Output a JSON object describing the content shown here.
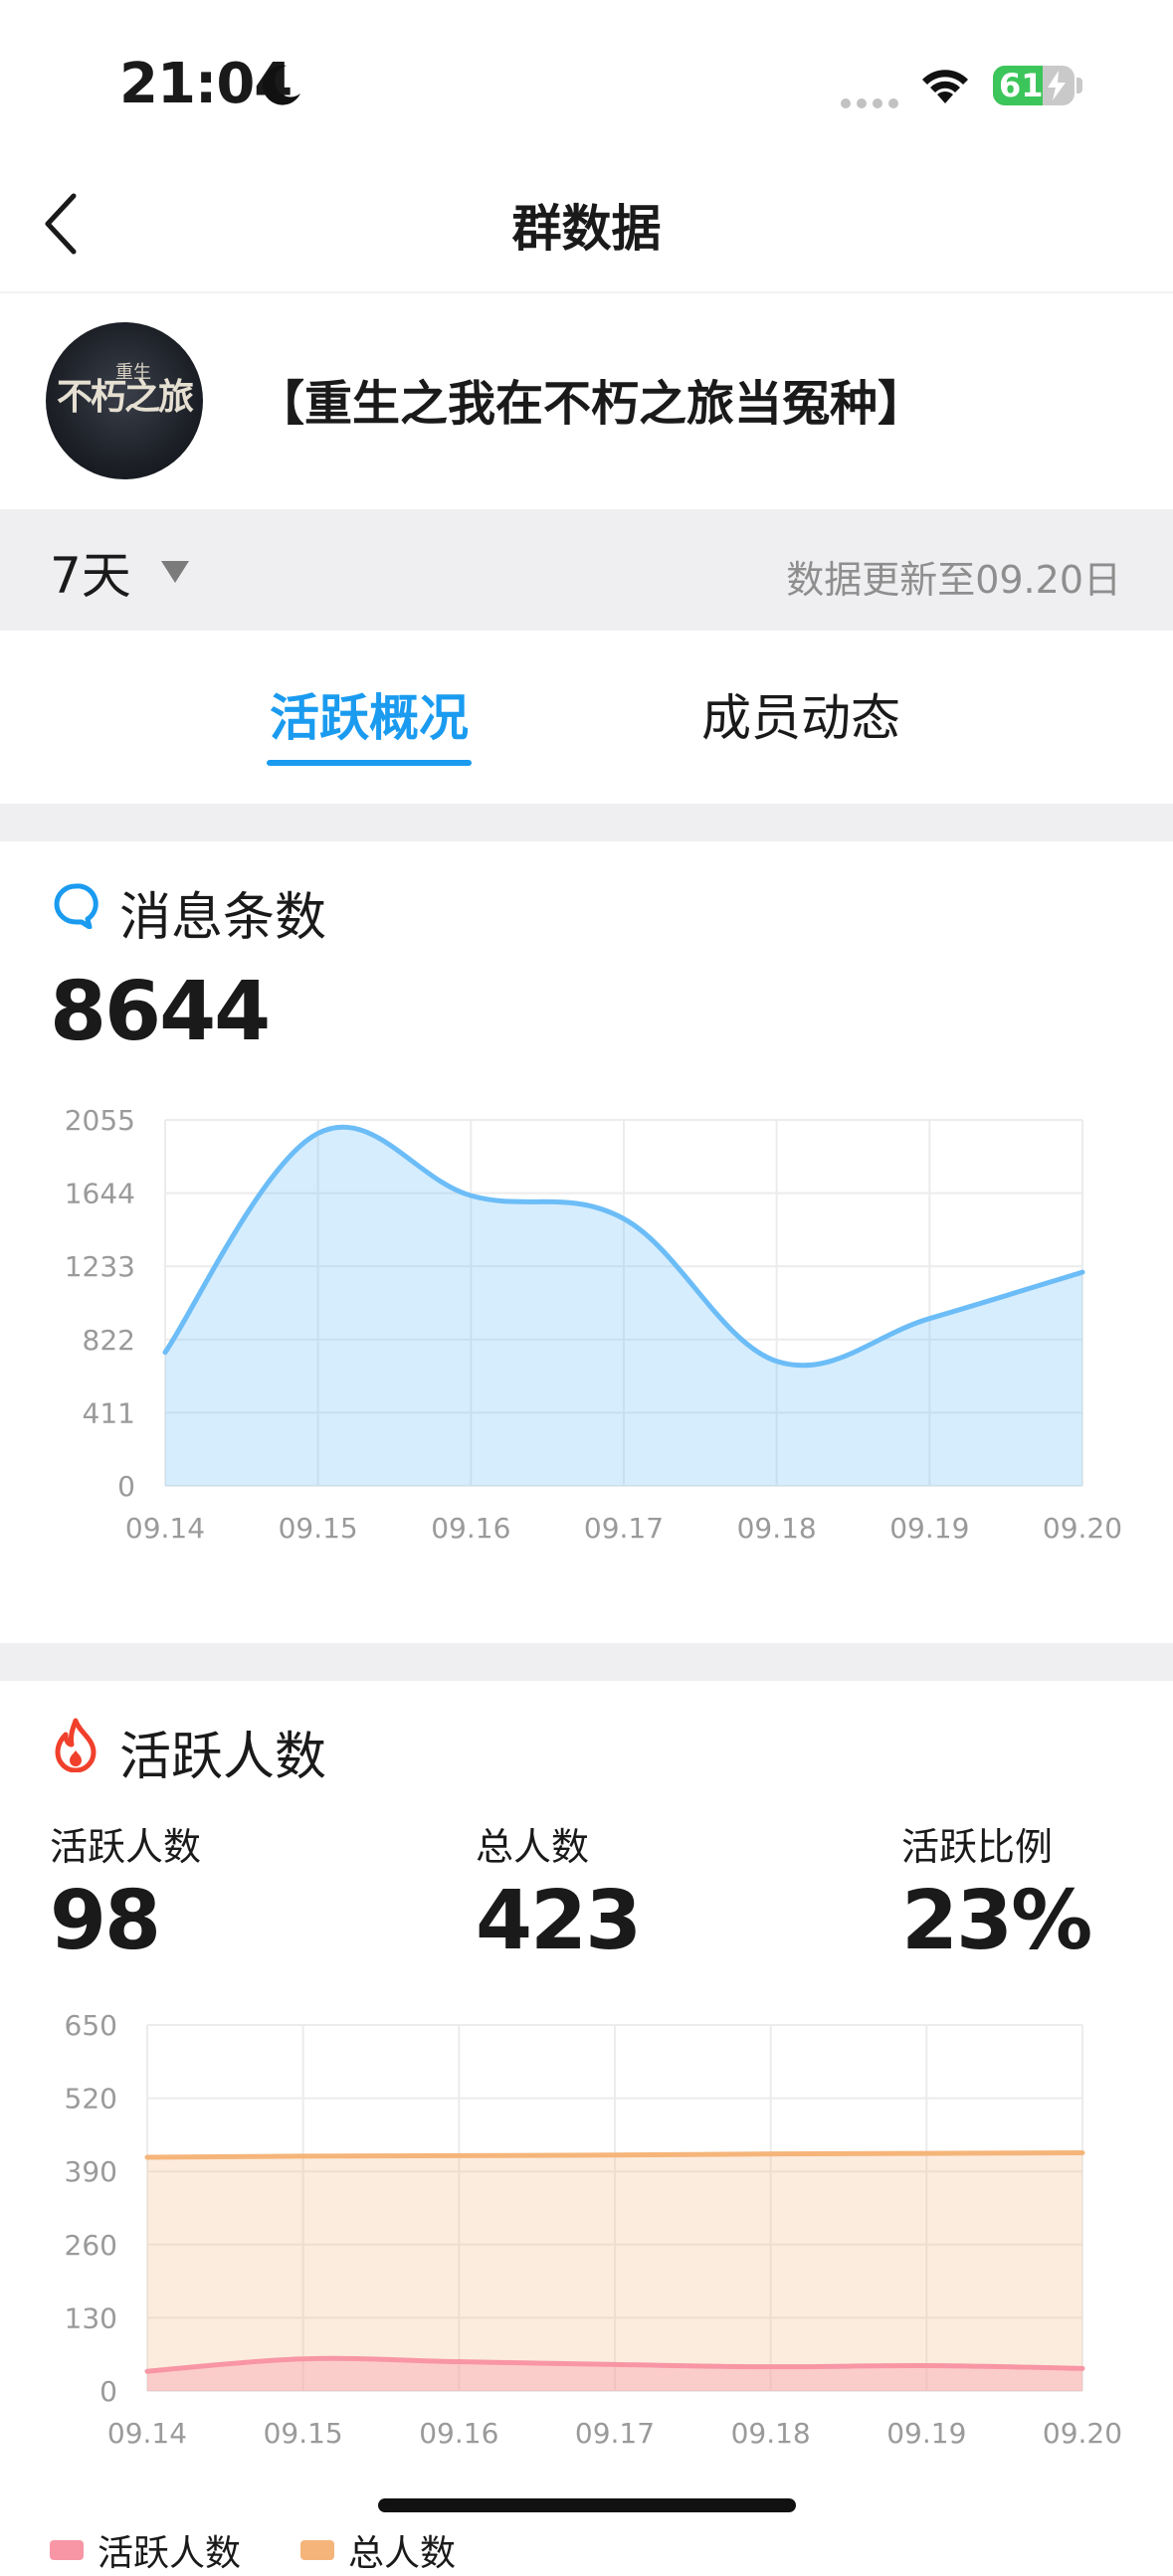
{
  "status_bar": {
    "time": "21:04",
    "battery": "61",
    "battery_level": 0.61
  },
  "nav": {
    "title": "群数据"
  },
  "group": {
    "name": "【重生之我在不朽之旅当冤种】",
    "avatar_small": "重生",
    "avatar_text": "不朽之旅"
  },
  "filter": {
    "period": "7天",
    "update_note": "数据更新至09.20日"
  },
  "tabs": [
    {
      "label": "活跃概况",
      "active": true
    },
    {
      "label": "成员动态",
      "active": false
    }
  ],
  "messages": {
    "title": "消息条数",
    "total": "8644",
    "chart_data": {
      "type": "area",
      "x": [
        "09.14",
        "09.15",
        "09.16",
        "09.17",
        "09.18",
        "09.19",
        "09.20"
      ],
      "y_ticks": [
        2055,
        1644,
        1233,
        822,
        411,
        0
      ],
      "ylim": [
        0,
        2055
      ],
      "series": [
        {
          "values": [
            750,
            1980,
            1630,
            1500,
            700,
            940,
            1200
          ],
          "color": "#6cbdf7"
        }
      ],
      "grid": true
    }
  },
  "active": {
    "title": "活跃人数",
    "stats": [
      {
        "label": "活跃人数",
        "value": "98"
      },
      {
        "label": "总人数",
        "value": "423"
      },
      {
        "label": "活跃比例",
        "value": "23%"
      }
    ],
    "legend": [
      "活跃人数",
      "总人数"
    ],
    "chart_data": {
      "type": "area",
      "x": [
        "09.14",
        "09.15",
        "09.16",
        "09.17",
        "09.18",
        "09.19",
        "09.20"
      ],
      "y_ticks": [
        650,
        520,
        390,
        260,
        130,
        0
      ],
      "ylim": [
        0,
        650
      ],
      "series": [
        {
          "name": "活跃人数",
          "values": [
            35,
            57,
            52,
            47,
            43,
            45,
            40
          ],
          "color": "#f896a6"
        },
        {
          "name": "总人数",
          "values": [
            415,
            417,
            418,
            419,
            421,
            422,
            423
          ],
          "color": "#f5b57a"
        }
      ],
      "grid": true
    }
  }
}
